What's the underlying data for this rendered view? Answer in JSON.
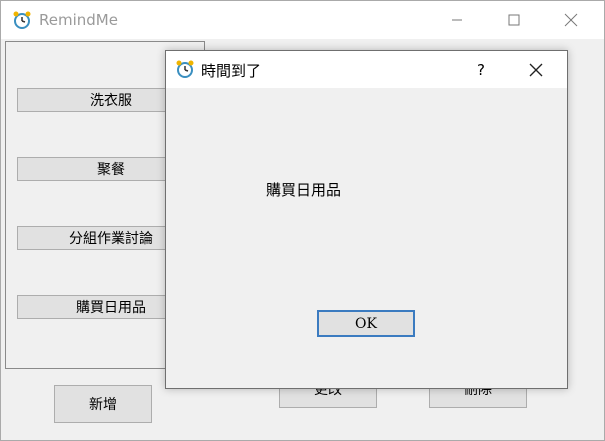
{
  "app": {
    "title": "RemindMe",
    "icon": "alarm-clock-icon"
  },
  "window_controls": [
    "minimize-icon",
    "maximize-icon",
    "close-icon"
  ],
  "tasks": [
    "洗衣服",
    "聚餐",
    "分組作業討論",
    "購買日用品"
  ],
  "actions": {
    "add": "新增",
    "edit": "更改",
    "delete": "刪除"
  },
  "dialog": {
    "title": "時間到了",
    "help": "?",
    "message": "購買日用品",
    "ok": "OK"
  },
  "colors": {
    "accent": "#3b7bc0",
    "button": "#e1e1e1",
    "background": "#f0f0f0"
  }
}
